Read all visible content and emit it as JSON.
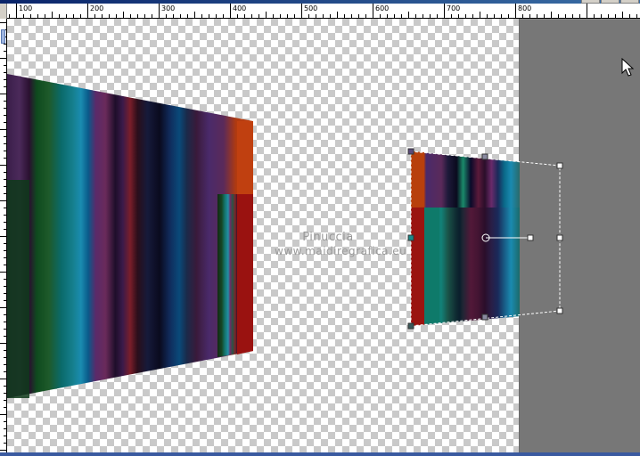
{
  "ruler": {
    "labels": [
      "100",
      "200",
      "300",
      "400",
      "500",
      "600",
      "700",
      "800"
    ]
  },
  "watermark": {
    "line1": "Pinuccia",
    "line2": "www.maidiregrafica.eu"
  },
  "colors": {
    "canvas_panel": "#777777",
    "selection_handle": "#ffffff",
    "ruler_bg": "#ffffff"
  },
  "icons": {
    "cursor": "arrow-cursor-icon",
    "rotation": "rotation-handle-icon"
  }
}
